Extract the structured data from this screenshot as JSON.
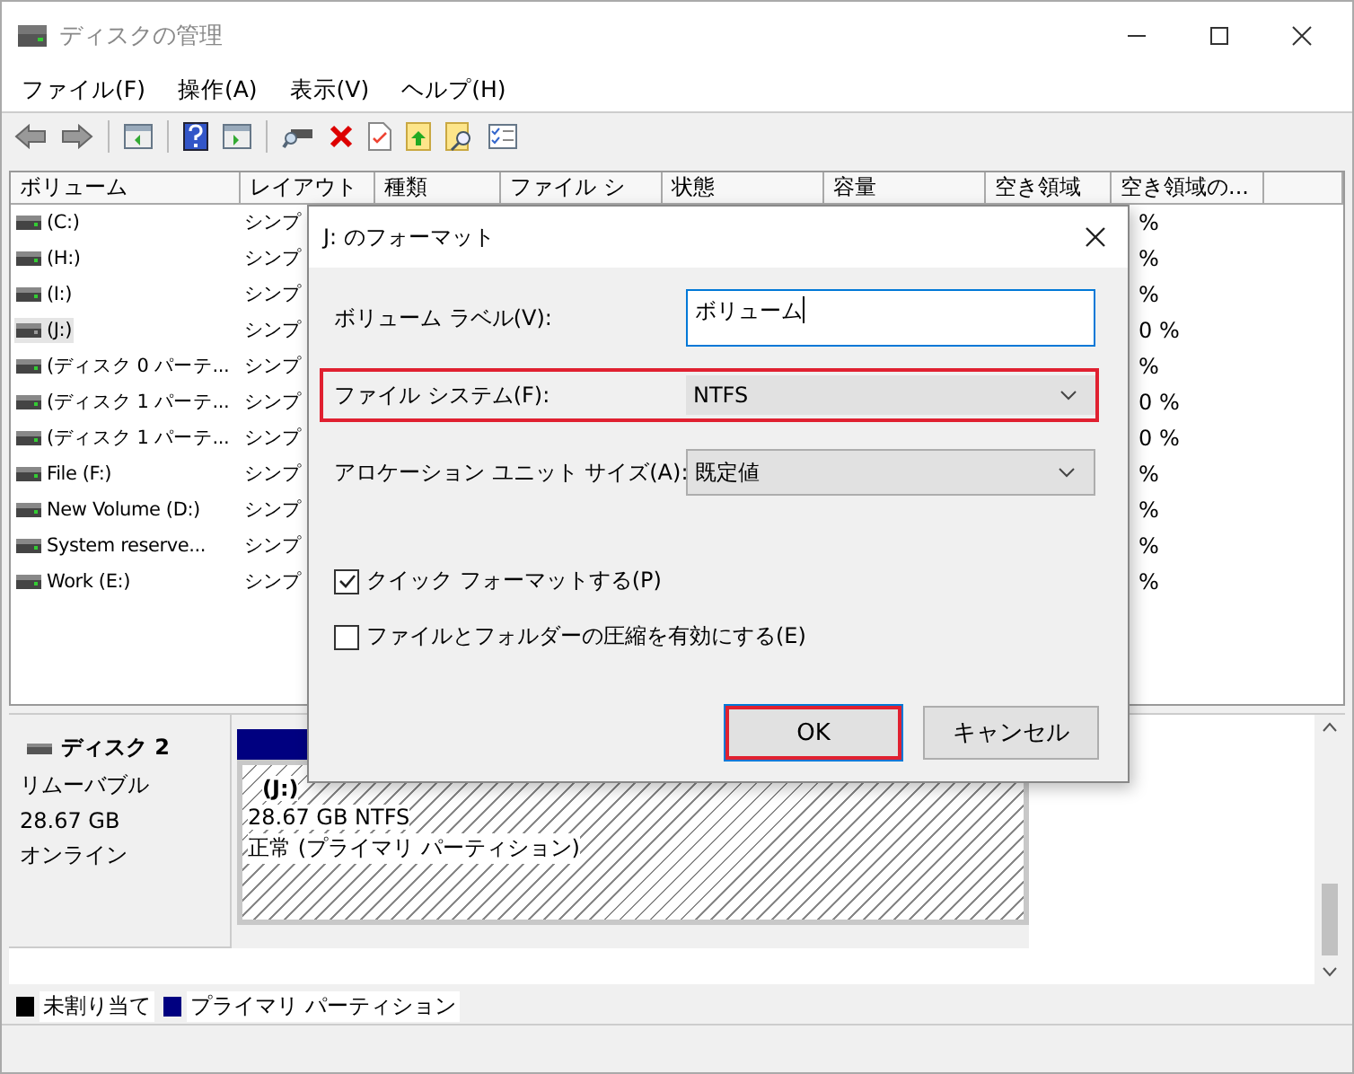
{
  "window": {
    "title": "ディスクの管理"
  },
  "menu": [
    "ファイル(F)",
    "操作(A)",
    "表示(V)",
    "ヘルプ(H)"
  ],
  "volume_table": {
    "columns": [
      "ボリューム",
      "レイアウト",
      "種類",
      "ファイル シ",
      "状態",
      "容量",
      "空き領域",
      "空き領域の..."
    ],
    "rows": [
      {
        "volume": "(C:)",
        "layout": "シンプ",
        "free_percent": "%",
        "selected": false
      },
      {
        "volume": "(H:)",
        "layout": "シンプ",
        "free_percent": "%",
        "selected": false
      },
      {
        "volume": "(I:)",
        "layout": "シンプ",
        "free_percent": "%",
        "selected": false
      },
      {
        "volume": "(J:)",
        "layout": "シンプ",
        "free_percent": "0 %",
        "selected": true
      },
      {
        "volume": "(ディスク 0 パーテ...",
        "layout": "シンプ",
        "free_percent": "%",
        "selected": false
      },
      {
        "volume": "(ディスク 1 パーテ...",
        "layout": "シンプ",
        "free_percent": "0 %",
        "selected": false
      },
      {
        "volume": "(ディスク 1 パーテ...",
        "layout": "シンプ",
        "free_percent": "0 %",
        "selected": false
      },
      {
        "volume": "File (F:)",
        "layout": "シンプ",
        "free_percent": "%",
        "selected": false
      },
      {
        "volume": "New Volume (D:)",
        "layout": "シンプ",
        "free_percent": "%",
        "selected": false
      },
      {
        "volume": "System reserve...",
        "layout": "シンプ",
        "free_percent": "%",
        "selected": false
      },
      {
        "volume": "Work (E:)",
        "layout": "シンプ",
        "free_percent": "%",
        "selected": false
      }
    ]
  },
  "disk": {
    "name": "ディスク 2",
    "type": "リムーバブル",
    "size": "28.67 GB",
    "status": "オンライン",
    "partition": {
      "name": "(J:)",
      "size": "28.67 GB NTFS",
      "status": "正常 (プライマリ パーティション)"
    }
  },
  "legend": [
    {
      "label": "未割り当て",
      "color": "#000000"
    },
    {
      "label": "プライマリ パーティション",
      "color": "#000080"
    }
  ],
  "dialog": {
    "title": "J: のフォーマット",
    "fields": [
      {
        "kind": "text",
        "label": "ボリューム ラベル(V):",
        "value": "ボリューム",
        "highlighted": false
      },
      {
        "kind": "select",
        "label": "ファイル システム(F):",
        "value": "NTFS",
        "highlighted": true
      },
      {
        "kind": "select",
        "label": "アロケーション ユニット サイズ(A):",
        "value": "既定値",
        "highlighted": false
      }
    ],
    "options": [
      {
        "label": "クイック フォーマットする(P)",
        "checked": true
      },
      {
        "label": "ファイルとフォルダーの圧縮を有効にする(E)",
        "checked": false
      }
    ],
    "buttons": [
      {
        "label": "OK",
        "highlighted": true
      },
      {
        "label": "キャンセル",
        "highlighted": false
      }
    ]
  }
}
